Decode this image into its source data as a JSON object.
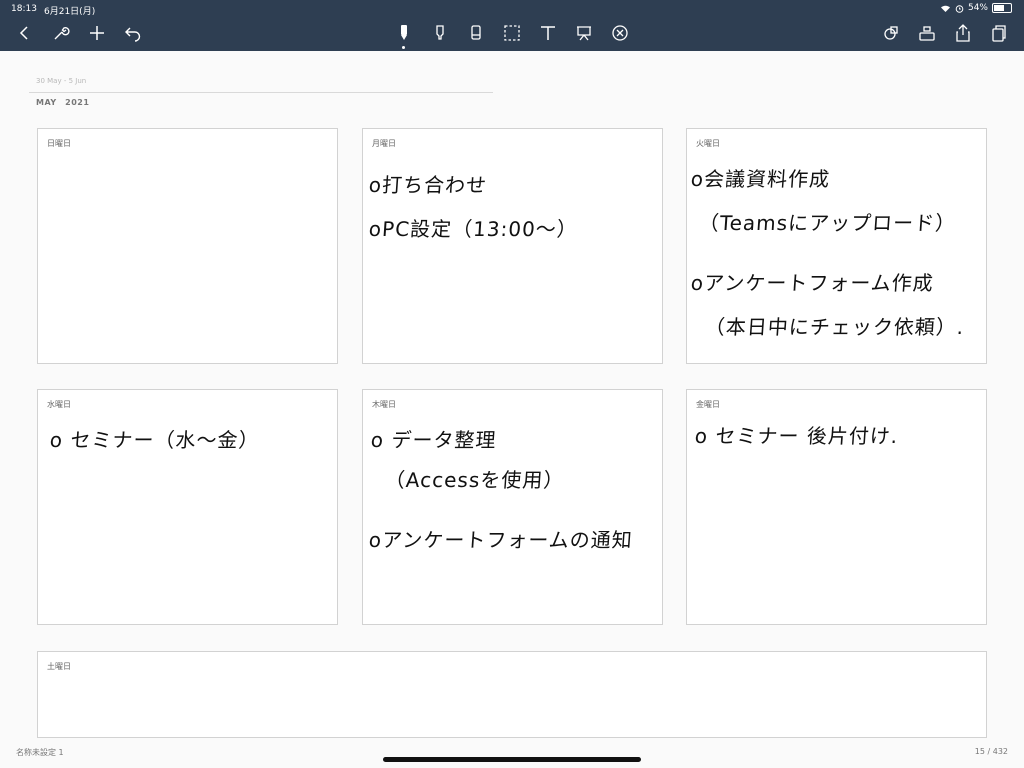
{
  "status": {
    "time": "18:13",
    "date": "6月21日(月)",
    "battery": "54%",
    "battery_level": 0.54
  },
  "toolbar": {
    "left_icons": [
      "back-icon",
      "wrench-icon",
      "plus-icon",
      "undo-icon"
    ],
    "center_icons": [
      "pen-icon",
      "highlighter-icon",
      "eraser-icon",
      "lasso-icon",
      "text-icon",
      "laser-pointer-icon",
      "close-circle-icon"
    ],
    "right_icons": [
      "shapes-icon",
      "zoom-window-icon",
      "share-icon",
      "pages-icon"
    ]
  },
  "planner": {
    "range": "30 May - 5 Jun",
    "month": "MAY　2021",
    "days": [
      {
        "label": "日曜日",
        "notes": []
      },
      {
        "label": "月曜日",
        "notes": [
          "o打ち合わせ",
          "oPC設定（13:00〜）"
        ]
      },
      {
        "label": "火曜日",
        "notes": [
          "o会議資料作成",
          "（Teamsにアップロード）",
          "oアンケートフォーム作成",
          "（本日中にチェック依頼）."
        ]
      },
      {
        "label": "水曜日",
        "notes": [
          "o セミナー（水〜金）"
        ]
      },
      {
        "label": "木曜日",
        "notes": [
          "o データ整理",
          "（Accessを使用）",
          "oアンケートフォームの通知"
        ]
      },
      {
        "label": "金曜日",
        "notes": [
          "o セミナー 後片付け."
        ]
      },
      {
        "label": "土曜日",
        "notes": []
      }
    ]
  },
  "footer": {
    "document_name": "名称未設定 1",
    "page_indicator": "15 / 432"
  }
}
